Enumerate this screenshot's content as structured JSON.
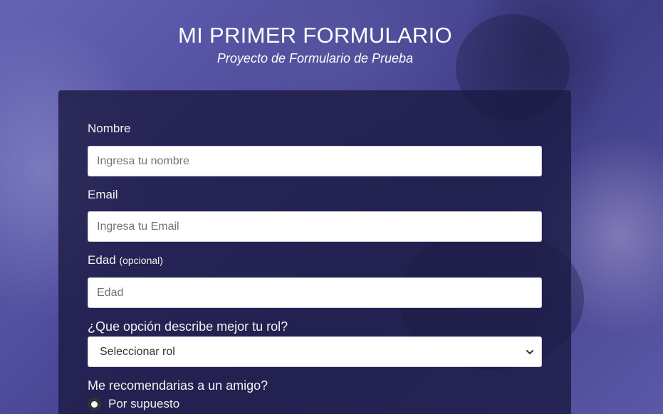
{
  "header": {
    "title": "MI PRIMER FORMULARIO",
    "subtitle": "Proyecto de Formulario de Prueba"
  },
  "form": {
    "name": {
      "label": "Nombre",
      "placeholder": "Ingresa tu nombre"
    },
    "email": {
      "label": "Email",
      "placeholder": "Ingresa tu Email"
    },
    "age": {
      "label": "Edad",
      "hint": "(opcional)",
      "placeholder": "Edad"
    },
    "role": {
      "label": "¿Que opción describe mejor tu rol?",
      "selected": "Seleccionar rol"
    },
    "recommend": {
      "label": "Me recomendarias a un amigo?",
      "options": [
        {
          "label": "Por supuesto"
        }
      ]
    }
  },
  "icons": {
    "select_arrow": "chevron-down-icon"
  },
  "colors": {
    "card_bg": "#1c1b44",
    "page_bg": "#4a4894"
  }
}
